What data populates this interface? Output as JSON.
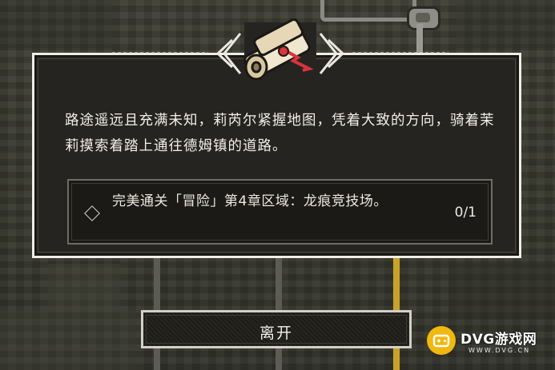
{
  "dialog": {
    "story_text": "路途遥远且充满未知，莉芮尔紧握地图，凭着大致的方向，骑着茉莉摸索着踏上通往德姆镇的道路。",
    "quest": {
      "icon": "diamond-icon",
      "text": "完美通关「冒险」第4章区域：龙痕竞技场。",
      "progress": "0/1"
    },
    "header_icon": "scroll-map-icon"
  },
  "leave_button": {
    "label": "离开"
  },
  "watermark": {
    "title": "DVG游戏网",
    "subtitle": "WWW.DVG.CN"
  },
  "colors": {
    "accent_gold": "#c9a227",
    "frame": "#f0ede6",
    "panel": "#262420"
  }
}
